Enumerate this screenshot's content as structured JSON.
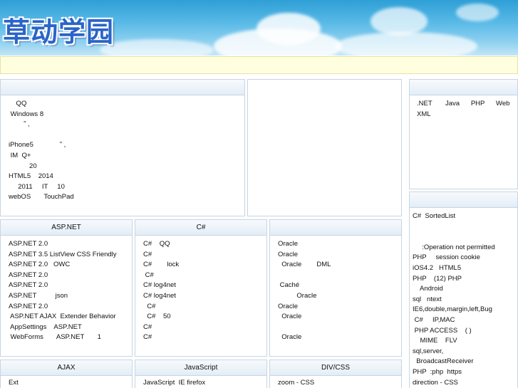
{
  "header": {
    "logo_text": "草动学园"
  },
  "notice": "",
  "featured": {
    "title": "",
    "items": [
      "    QQ",
      " Windows 8",
      "        ˮ ,",
      "",
      "iPhone5              ˮ ,",
      " IM  Q+",
      "           20",
      "HTML5    2014",
      "     2011     IT     10",
      "webOS       TouchPad"
    ]
  },
  "middle_box": {
    "title": ""
  },
  "topics": {
    "title": "",
    "items": [
      ".NET       Java      PHP      Web",
      "XML"
    ]
  },
  "latest": {
    "title": "",
    "items": [
      "C#  SortedList",
      "",
      "",
      "     :Operation not permitted",
      "PHP     session cookie",
      "iOS4.2   HTML5",
      "PHP    (12) PHP",
      "    Android",
      "sql   ntext",
      "IE6,double,margin,left,Bug",
      " C#     IP,MAC",
      " PHP ACCESS    ( )",
      "    MIME    FLV",
      "sql,server,",
      "  BroadcastReceiver",
      "PHP  :php  https",
      "direction - CSS"
    ]
  },
  "aspnet": {
    "title": "ASP.NET",
    "items": [
      "ASP.NET 2.0",
      "ASP.NET 3.5 ListView CSS Friendly",
      "ASP.NET 2.0   OWC",
      "ASP.NET 2.0",
      "ASP.NET 2.0",
      "ASP.NET          json",
      "ASP.NET 2.0",
      " ASP.NET AJAX  Extender Behavior",
      " AppSettings    ASP.NET",
      " WebForms       ASP.NET       1"
    ]
  },
  "csharp": {
    "title": "C#",
    "items": [
      "C#    QQ",
      "C#",
      "C#        lock",
      " C#",
      "C# log4net",
      "C# log4net",
      "  C#",
      "  C#    50",
      "C#",
      "C#"
    ]
  },
  "database": {
    "title": "",
    "items": [
      "Oracle",
      "Oracle",
      "  Oracle        DML",
      "",
      " Caché",
      "          Oracle",
      "Oracle",
      "  Oracle",
      "",
      "  Oracle"
    ]
  },
  "ajax": {
    "title": "AJAX",
    "items": [
      "Ext"
    ]
  },
  "javascript": {
    "title": "JavaScript",
    "items": [
      "JavaScript  IE firefox"
    ]
  },
  "divcss": {
    "title": "DIV/CSS",
    "items": [
      "zoom - CSS"
    ]
  }
}
